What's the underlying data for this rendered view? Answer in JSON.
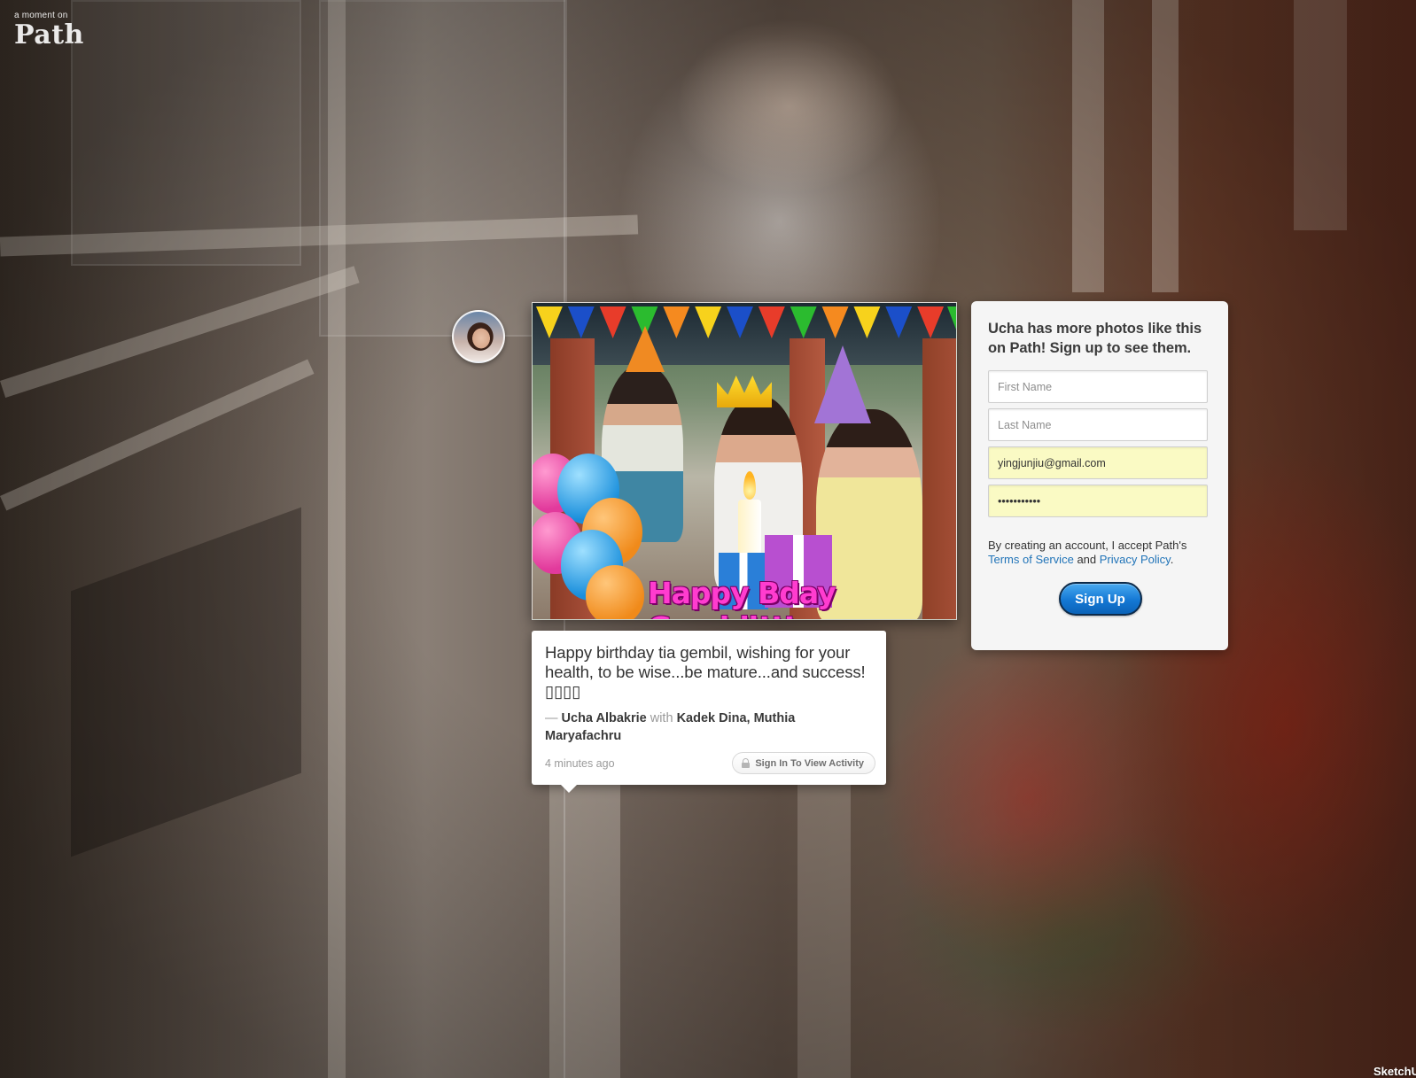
{
  "logo": {
    "tagline": "a moment on",
    "name": "Path"
  },
  "moment": {
    "photo_caption": "Happy Bday Gembil!!!",
    "text": "Happy birthday tia gembil, wishing for your health, to be wise...be mature...and success! ▯▯▯▯",
    "dash": "—",
    "author": "Ucha Albakrie",
    "with_label": "with",
    "tagged": "Kadek Dina, Muthia Maryafachru",
    "time": "4 minutes ago",
    "activity_button": "Sign In To View Activity"
  },
  "signup": {
    "heading": "Ucha has more photos like this on Path! Sign up to see them.",
    "first_name_placeholder": "First Name",
    "last_name_placeholder": "Last Name",
    "email_value": "yingjunjiu@gmail.com",
    "password_value": "•••••••••••",
    "terms_prefix": "By creating an account, I accept Path's",
    "terms_link": "Terms of Service",
    "terms_and": "and",
    "privacy_link": "Privacy Policy",
    "terms_end": ".",
    "button_label": "Sign Up"
  },
  "watermark": "SketchU",
  "colors": {
    "link": "#2174b8",
    "button": "#1478d4",
    "autofill": "#fafac4",
    "caption_pink": "#ff3ccf"
  },
  "icons": [
    "lock-icon",
    "avatar"
  ]
}
